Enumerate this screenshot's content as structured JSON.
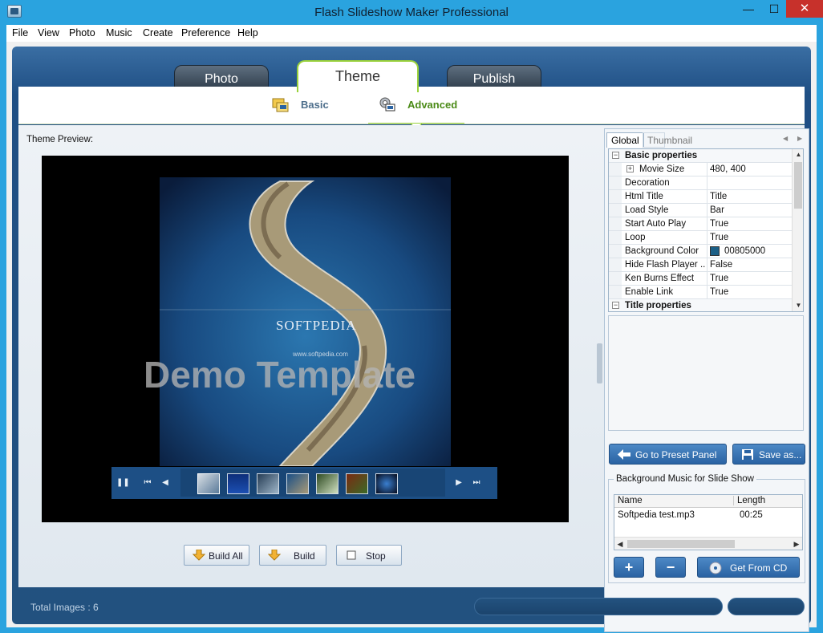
{
  "window": {
    "title": "Flash Slideshow Maker Professional",
    "min_glyph": "—",
    "max_glyph": "☐",
    "close_glyph": "✕"
  },
  "menu": [
    "File",
    "View",
    "Photo",
    "Music",
    "Create",
    "Preference",
    "Help"
  ],
  "main_tabs": [
    {
      "label": "Photo",
      "active": false
    },
    {
      "label": "Theme",
      "active": true
    },
    {
      "label": "Publish",
      "active": false
    }
  ],
  "sub_tabs": [
    {
      "label": "Basic",
      "active": false
    },
    {
      "label": "Advanced",
      "active": true
    }
  ],
  "preview": {
    "label": "Theme Preview:",
    "watermark_brand": "SOFTPEDIA",
    "watermark_url": "www.softpedia.com",
    "overlay": "Demo Template",
    "thumbnail_count": 7
  },
  "build_buttons": {
    "build_all": "Build All",
    "build": "Build",
    "stop": "Stop"
  },
  "properties": {
    "tabs": [
      "Global",
      "Thumbnail"
    ],
    "rows": [
      {
        "kind": "category",
        "name": "Basic properties",
        "expander": "−"
      },
      {
        "kind": "sub",
        "name": "Movie Size",
        "value": "480, 400",
        "expander": "+"
      },
      {
        "kind": "prop",
        "name": "Decoration",
        "value": ""
      },
      {
        "kind": "prop",
        "name": "Html Title",
        "value": "Title"
      },
      {
        "kind": "prop",
        "name": "Load Style",
        "value": "Bar"
      },
      {
        "kind": "prop",
        "name": "Start Auto Play",
        "value": "True"
      },
      {
        "kind": "prop",
        "name": "Loop",
        "value": "True"
      },
      {
        "kind": "color",
        "name": "Background Color",
        "value": "00805000",
        "swatch": "#1b5f86"
      },
      {
        "kind": "prop",
        "name": "Hide Flash Player ...",
        "value": "False"
      },
      {
        "kind": "prop",
        "name": "Ken Burns Effect",
        "value": "True"
      },
      {
        "kind": "prop",
        "name": "Enable Link",
        "value": "True"
      },
      {
        "kind": "category",
        "name": "Title properties",
        "expander": "−"
      }
    ]
  },
  "preset": {
    "go_label": "Go to Preset Panel",
    "save_label": "Save as..."
  },
  "music": {
    "group_label": "Background Music for Slide Show",
    "columns": [
      "Name",
      "Length"
    ],
    "tracks": [
      {
        "name": "Softpedia test.mp3",
        "length": "00:25"
      }
    ],
    "add_label": "+",
    "remove_label": "−",
    "get_cd_label": "Get From CD"
  },
  "status": {
    "text": "Total Images : 6"
  },
  "colors": {
    "titlebar": "#2aa3df",
    "frame_blue": "#1f4f84",
    "accent_green": "#9ad23b",
    "close_red": "#c7312b"
  }
}
